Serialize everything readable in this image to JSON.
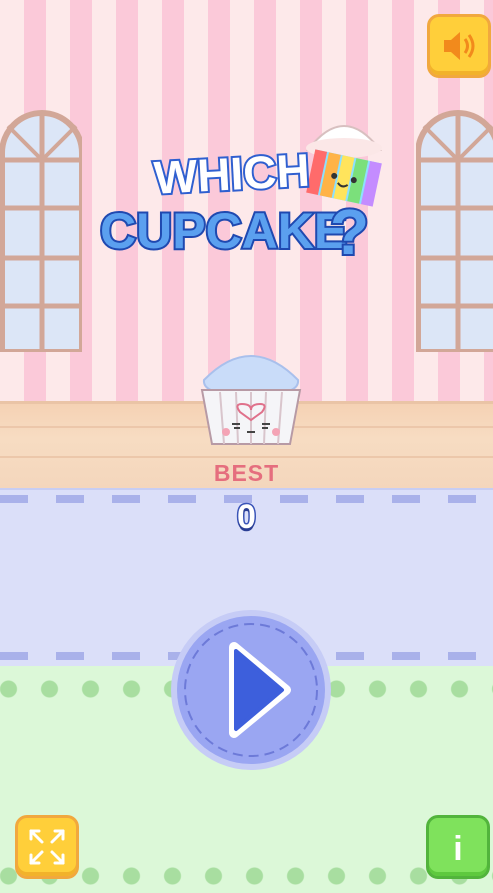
{
  "game": {
    "title_line1": "WHICH",
    "title_line2": "CUPCAKE",
    "title_mark": "?",
    "best_label": "BEST",
    "best_score": "0"
  },
  "buttons": {
    "sound_icon": "speaker-icon",
    "play_icon": "play-icon",
    "fullscreen_icon": "fullscreen-icon",
    "info_icon": "info-icon",
    "info_glyph": "i"
  },
  "colors": {
    "accent_yellow": "#ffcf3a",
    "accent_green": "#7fe25c",
    "play_blue": "#9aa6f2",
    "title_blue": "#2f5fd0",
    "best_pink": "#e56e7e"
  }
}
